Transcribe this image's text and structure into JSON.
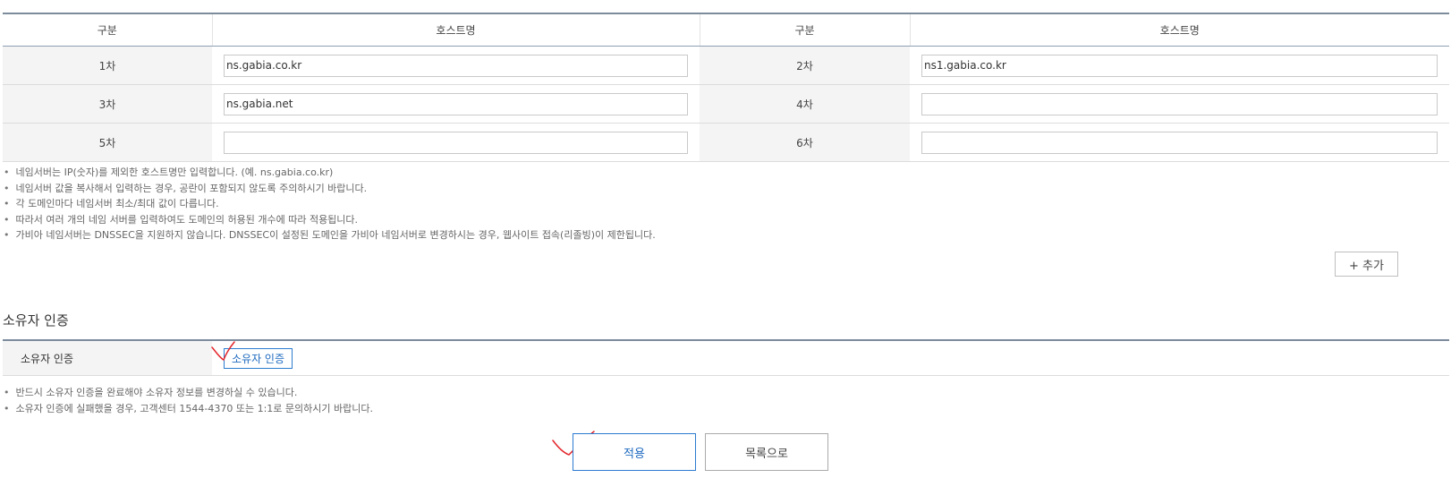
{
  "nameserver_table": {
    "headers": [
      "구분",
      "호스트명",
      "구분",
      "호스트명"
    ],
    "rows": [
      {
        "left_label": "1차",
        "left_value": "ns.gabia.co.kr",
        "right_label": "2차",
        "right_value": "ns1.gabia.co.kr"
      },
      {
        "left_label": "3차",
        "left_value": "ns.gabia.net",
        "right_label": "4차",
        "right_value": ""
      },
      {
        "left_label": "5차",
        "left_value": "",
        "right_label": "6차",
        "right_value": ""
      }
    ]
  },
  "nameserver_notes": [
    "네임서버는 IP(숫자)를 제외한 호스트명만 입력합니다. (예. ns.gabia.co.kr)",
    "네임서버 값을 복사해서 입력하는 경우, 공란이 포함되지 않도록 주의하시기 바랍니다.",
    "각 도메인마다 네임서버 최소/최대 값이 다릅니다.",
    "따라서 여러 개의 네임 서버를 입력하여도 도메인의 허용된 개수에 따라 적용됩니다.",
    "가비아 네임서버는 DNSSEC을 지원하지 않습니다. DNSSEC이 설정된 도메인을 가비아 네임서버로 변경하시는 경우, 웹사이트 접속(리졸빙)이 제한됩니다."
  ],
  "add_button": "+ 추가",
  "owner_section": {
    "title": "소유자 인증",
    "row_label": "소유자 인증",
    "verify_button": "소유자 인증",
    "notes": [
      "반드시 소유자 인증을 완료해야 소유자 정보를 변경하실 수 있습니다.",
      "소유자 인증에 실패했을 경우, 고객센터 1544-4370 또는 1:1로 문의하시기 바랍니다."
    ]
  },
  "actions": {
    "apply": "적용",
    "list": "목록으로"
  },
  "colors": {
    "accent": "#2c7bd0",
    "annotation": "#e3262b",
    "table_border": "#7d8c9c",
    "label_bg": "#f4f4f4"
  }
}
